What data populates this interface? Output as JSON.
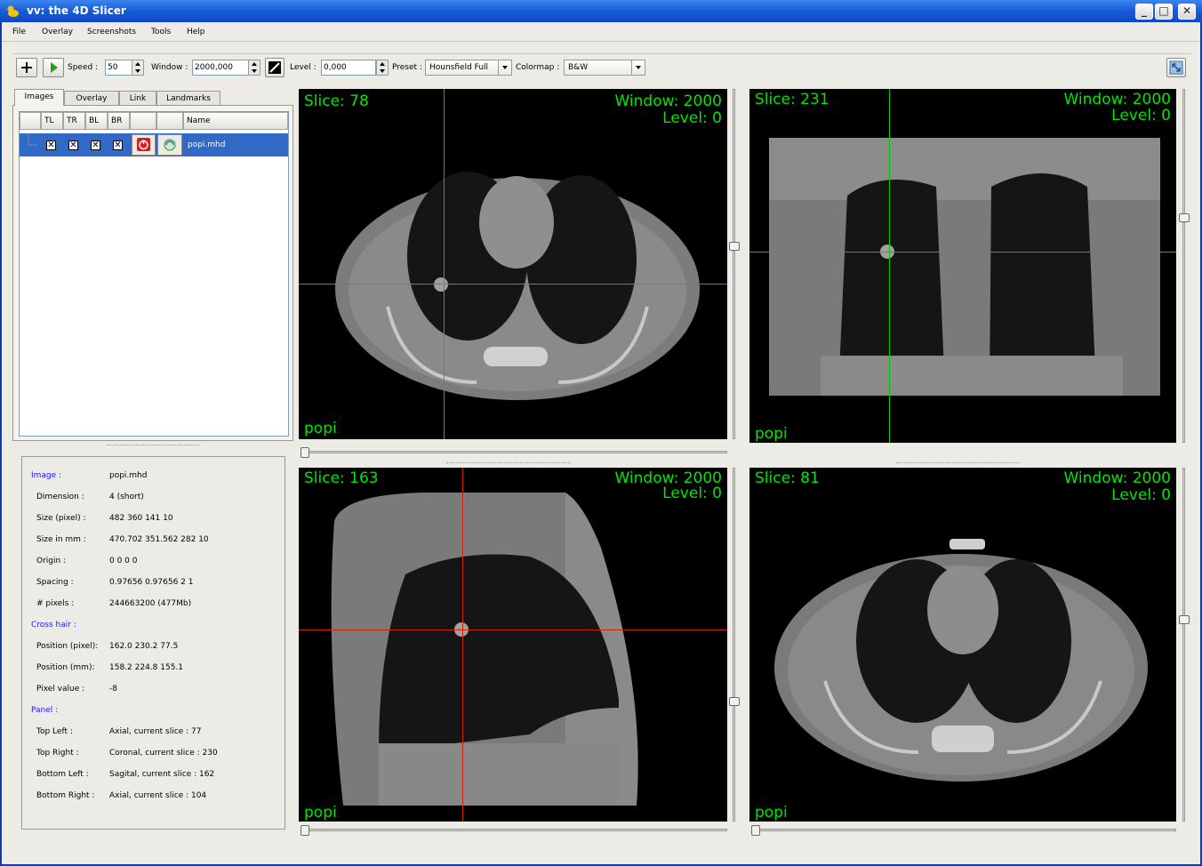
{
  "window": {
    "title": "vv: the 4D Slicer",
    "min": "_",
    "max": "□",
    "close": "✕"
  },
  "menu": [
    "File",
    "Overlay",
    "Screenshots",
    "Tools",
    "Help"
  ],
  "toolbar": {
    "speed_label": "Speed :",
    "speed_value": "50",
    "window_label": "Window :",
    "window_value": "2000,000",
    "level_label": "Level :",
    "level_value": "0,000",
    "preset_label": "Preset :",
    "preset_value": "Hounsfield Full",
    "colormap_label": "Colormap :",
    "colormap_value": "B&W"
  },
  "tabs": [
    "Images",
    "Overlay",
    "Link",
    "Landmarks"
  ],
  "image_list": {
    "headers": [
      "TL",
      "TR",
      "BL",
      "BR",
      "",
      "",
      "Name"
    ],
    "rows": [
      {
        "name": "popi.mhd",
        "tl": "✕",
        "tr": "✕",
        "bl": "✕",
        "br": "✕"
      }
    ]
  },
  "info": {
    "image_heading": "Image :",
    "image_value": "popi.mhd",
    "rows1": [
      {
        "k": "Dimension :",
        "v": "4 (short)"
      },
      {
        "k": "Size (pixel) :",
        "v": "482 360 141 10"
      },
      {
        "k": "Size in mm :",
        "v": "470.702 351.562 282 10"
      },
      {
        "k": "Origin :",
        "v": "0 0 0 0"
      },
      {
        "k": "Spacing :",
        "v": "0.97656 0.97656 2 1"
      },
      {
        "k": "# pixels :",
        "v": "244663200 (477Mb)"
      }
    ],
    "crosshair_heading": "Cross hair :",
    "rows2": [
      {
        "k": "Position (pixel):",
        "v": "162.0 230.2 77.5"
      },
      {
        "k": "Position (mm):",
        "v": "158.2 224.8 155.1"
      },
      {
        "k": "Pixel value :",
        "v": "-8"
      }
    ],
    "panel_heading": "Panel :",
    "rows3": [
      {
        "k": "Top Left :",
        "v": "Axial,    current slice : 77"
      },
      {
        "k": "Top Right :",
        "v": "Coronal, current slice : 230"
      },
      {
        "k": "Bottom Left :",
        "v": "Sagital,  current slice : 162"
      },
      {
        "k": "Bottom Right :",
        "v": "Axial,    current slice : 104"
      }
    ]
  },
  "views": {
    "tl": {
      "slice": "Slice: 78",
      "window": "Window: 2000",
      "level": "Level: 0",
      "name": "popi"
    },
    "tr": {
      "slice": "Slice: 231",
      "window": "Window: 2000",
      "level": "Level: 0",
      "name": "popi"
    },
    "bl": {
      "slice": "Slice: 163",
      "window": "Window: 2000",
      "level": "Level: 0",
      "name": "popi"
    },
    "br": {
      "slice": "Slice: 81",
      "window": "Window: 2000",
      "level": "Level: 0",
      "name": "popi"
    }
  },
  "colors": {
    "overlay_text": "#00e600",
    "crosshair_green": "#00cc00",
    "crosshair_red": "#cc2200",
    "selection": "#3169c6",
    "heading": "#1a1aff"
  }
}
